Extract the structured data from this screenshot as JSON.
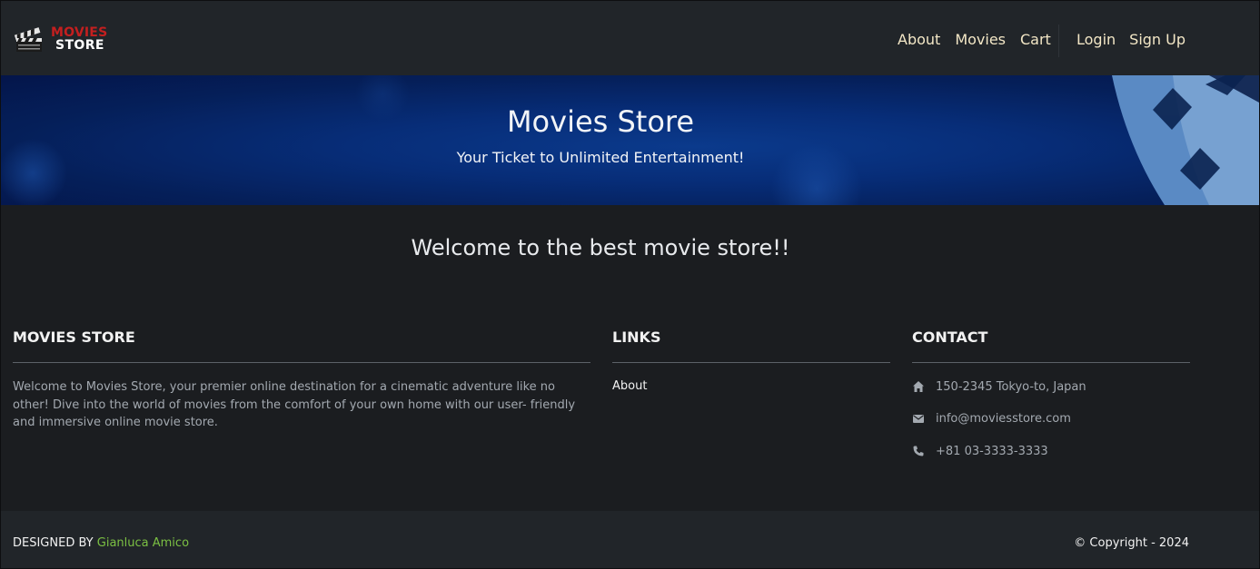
{
  "brand": {
    "line1": "MOVIES",
    "line2": "STORE",
    "logo_icon": "clapperboard-icon"
  },
  "nav": {
    "left": [
      "About",
      "Movies",
      "Cart"
    ],
    "right": [
      "Login",
      "Sign Up"
    ]
  },
  "hero": {
    "title": "Movies Store",
    "subtitle": "Your Ticket to Unlimited Entertainment!"
  },
  "main": {
    "welcome": "Welcome to the best movie store!!"
  },
  "footer": {
    "about": {
      "title": "MOVIES STORE",
      "text": "Welcome to Movies Store, your premier online destination for a cinematic adventure like no other! Dive into the world of movies from the comfort of your own home with our user- friendly and immersive online movie store."
    },
    "links": {
      "title": "LINKS",
      "items": [
        "About"
      ]
    },
    "contact": {
      "title": "CONTACT",
      "address": "150-2345 Tokyo-to, Japan",
      "email": "info@moviesstore.com",
      "phone": "+81 03-3333-3333",
      "icons": [
        "home-icon",
        "envelope-icon",
        "phone-icon"
      ]
    }
  },
  "bottom": {
    "designed_by": "DESIGNED BY",
    "author": "Gianluca Amico",
    "copyright": "© Copyright - 2024"
  },
  "colors": {
    "nav_bg": "#212529",
    "page_bg": "#1b1d20",
    "hero_blue": "#072d78",
    "brand_red": "#c41f1f",
    "nav_link": "#f3e7c6",
    "author_link": "#7bc043"
  }
}
